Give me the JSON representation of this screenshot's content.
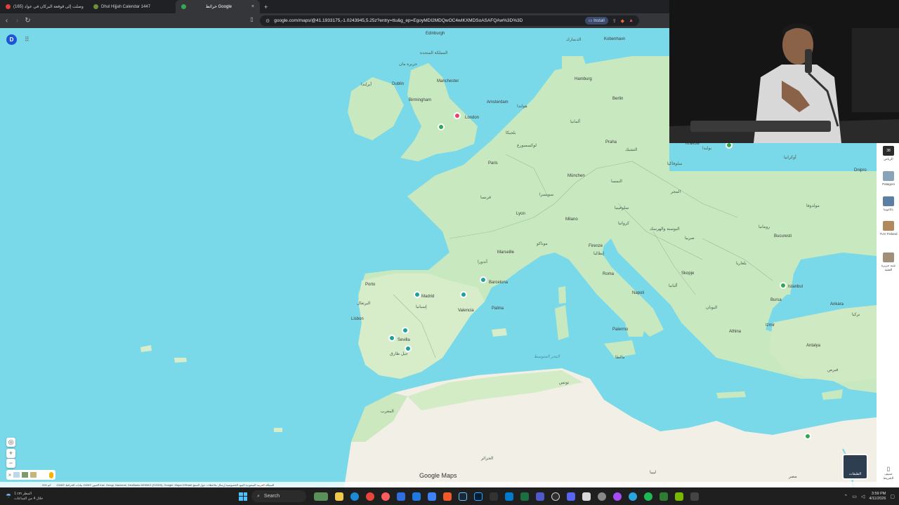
{
  "tabs": [
    {
      "title": "(165) وصلت إلى قوقعة البركان في عواد",
      "color": "#e0413a"
    },
    {
      "title": "Dhul Hijjah Calendar 1447",
      "color": "#6d8f3c"
    },
    {
      "title": "خرائط Google",
      "color": "#34a853",
      "active": true
    }
  ],
  "new_tab": "+",
  "close_tab": "×",
  "toolbar": {
    "url": "google.com/maps/@41.1933175,-1.0243945,5.25z?entry=ttu&g_ep=EgoyMDI2MDQwOC4wIKXMDSoASAFQAw%3D%3D",
    "install_label": "Install"
  },
  "map": {
    "account_initial": "D",
    "logo": "Google Maps",
    "labels": [
      {
        "t": "Edinburgh",
        "k": "city"
      },
      {
        "t": "المملكة المتحدة",
        "k": "country"
      },
      {
        "t": "جزيرة مان",
        "k": "country"
      },
      {
        "t": "Dublin",
        "k": "city"
      },
      {
        "t": "أيرلندا",
        "k": "country"
      },
      {
        "t": "Manchester",
        "k": "city"
      },
      {
        "t": "Birmingham",
        "k": "city"
      },
      {
        "t": "London",
        "k": "city"
      },
      {
        "t": "Amsterdam",
        "k": "city"
      },
      {
        "t": "هولندا",
        "k": "country"
      },
      {
        "t": "بلجيكا",
        "k": "country"
      },
      {
        "t": "لوكسمبورغ",
        "k": "country"
      },
      {
        "t": "Paris",
        "k": "city"
      },
      {
        "t": "فرنسا",
        "k": "country"
      },
      {
        "t": "Lyon",
        "k": "city"
      },
      {
        "t": "Marseille",
        "k": "city"
      },
      {
        "t": "موناكو",
        "k": "country"
      },
      {
        "t": "أندورا",
        "k": "country"
      },
      {
        "t": "Porto",
        "k": "city"
      },
      {
        "t": "البرتغال",
        "k": "country"
      },
      {
        "t": "Lisbon",
        "k": "city"
      },
      {
        "t": "Madrid",
        "k": "city"
      },
      {
        "t": "إسبانيا",
        "k": "country"
      },
      {
        "t": "Valencia",
        "k": "city"
      },
      {
        "t": "Barcelona",
        "k": "city"
      },
      {
        "t": "Palma",
        "k": "city"
      },
      {
        "t": "Sevilla",
        "k": "city"
      },
      {
        "t": "جبل طارق",
        "k": "country"
      },
      {
        "t": "المغرب",
        "k": "country"
      },
      {
        "t": "الجزائر",
        "k": "country"
      },
      {
        "t": "تونس",
        "k": "country"
      },
      {
        "t": "مالطا",
        "k": "country"
      },
      {
        "t": "Hamburg",
        "k": "city"
      },
      {
        "t": "Berlin",
        "k": "city"
      },
      {
        "t": "ألمانيا",
        "k": "country"
      },
      {
        "t": "Kobenhavn",
        "k": "city"
      },
      {
        "t": "الدنمارك",
        "k": "country"
      },
      {
        "t": "Praha",
        "k": "city"
      },
      {
        "t": "التشيك",
        "k": "country"
      },
      {
        "t": "München",
        "k": "city"
      },
      {
        "t": "النمسا",
        "k": "country"
      },
      {
        "t": "سويسرا",
        "k": "country"
      },
      {
        "t": "Milano",
        "k": "city"
      },
      {
        "t": "Firenze",
        "k": "city"
      },
      {
        "t": "إيطاليا",
        "k": "country"
      },
      {
        "t": "Roma",
        "k": "city"
      },
      {
        "t": "Napoli",
        "k": "city"
      },
      {
        "t": "Palermo",
        "k": "city"
      },
      {
        "t": "سلوفينيا",
        "k": "country"
      },
      {
        "t": "كرواتيا",
        "k": "country"
      },
      {
        "t": "البوسنة والهرسك",
        "k": "country"
      },
      {
        "t": "صربيا",
        "k": "country"
      },
      {
        "t": "المجر",
        "k": "country"
      },
      {
        "t": "سلوفاكيا",
        "k": "country"
      },
      {
        "t": "بولندا",
        "k": "country"
      },
      {
        "t": "Kraków",
        "k": "city"
      },
      {
        "t": "أوكرانيا",
        "k": "country"
      },
      {
        "t": "Dnipro",
        "k": "city"
      },
      {
        "t": "مولدوفا",
        "k": "country"
      },
      {
        "t": "رومانيا",
        "k": "country"
      },
      {
        "t": "Bucuresti",
        "k": "city"
      },
      {
        "t": "بلغاريا",
        "k": "country"
      },
      {
        "t": "Skopje",
        "k": "city"
      },
      {
        "t": "ألبانيا",
        "k": "country"
      },
      {
        "t": "اليونان",
        "k": "country"
      },
      {
        "t": "Athina",
        "k": "city"
      },
      {
        "t": "Istanbul",
        "k": "city"
      },
      {
        "t": "Bursa",
        "k": "city"
      },
      {
        "t": "Ankara",
        "k": "city"
      },
      {
        "t": "تركيا",
        "k": "country"
      },
      {
        "t": "Izmir",
        "k": "city"
      },
      {
        "t": "Antalya",
        "k": "city"
      },
      {
        "t": "قبرص",
        "k": "country"
      },
      {
        "t": "مصر",
        "k": "country"
      },
      {
        "t": "ليبيا",
        "k": "country"
      },
      {
        "t": "البحر المتوسط",
        "k": "sea"
      }
    ],
    "layers_label": "الطبقات",
    "footer": "الصور ©2026 بيانات الخرائط ©2026 Inst. Geogr. Nacional, GeoBasis-DE/BKG (©2009), Google, Mapa GISrael    المملكة العربية السعودية    البنود    الخصوصية    إرسال ملاحظات حول المنتج",
    "scale": "200 كم",
    "right_panel": [
      {
        "label": "الرياض",
        "badge": "38"
      },
      {
        "label": "Patagoni"
      },
      {
        "label": "باتاغونيا"
      },
      {
        "label": "TUV Finland"
      },
      {
        "label": "شبه جزيرة العقبة"
      }
    ],
    "right_panel_bottom": "صنيف الشريط"
  },
  "taskbar": {
    "weather_temp": "1 cm",
    "weather_desc": "المطر",
    "weather_sub": "خلال 4 من الساعات",
    "search_placeholder": "Search",
    "time": "3:59 PM",
    "date": "4/11/2026"
  },
  "colors": {
    "sea": "#7ad9e9",
    "land": "#c8e9c0",
    "desert": "#f2efe6",
    "pin_teal": "#1aa39b",
    "pin_green": "#2fa84f",
    "pin_pink": "#e6426e"
  }
}
